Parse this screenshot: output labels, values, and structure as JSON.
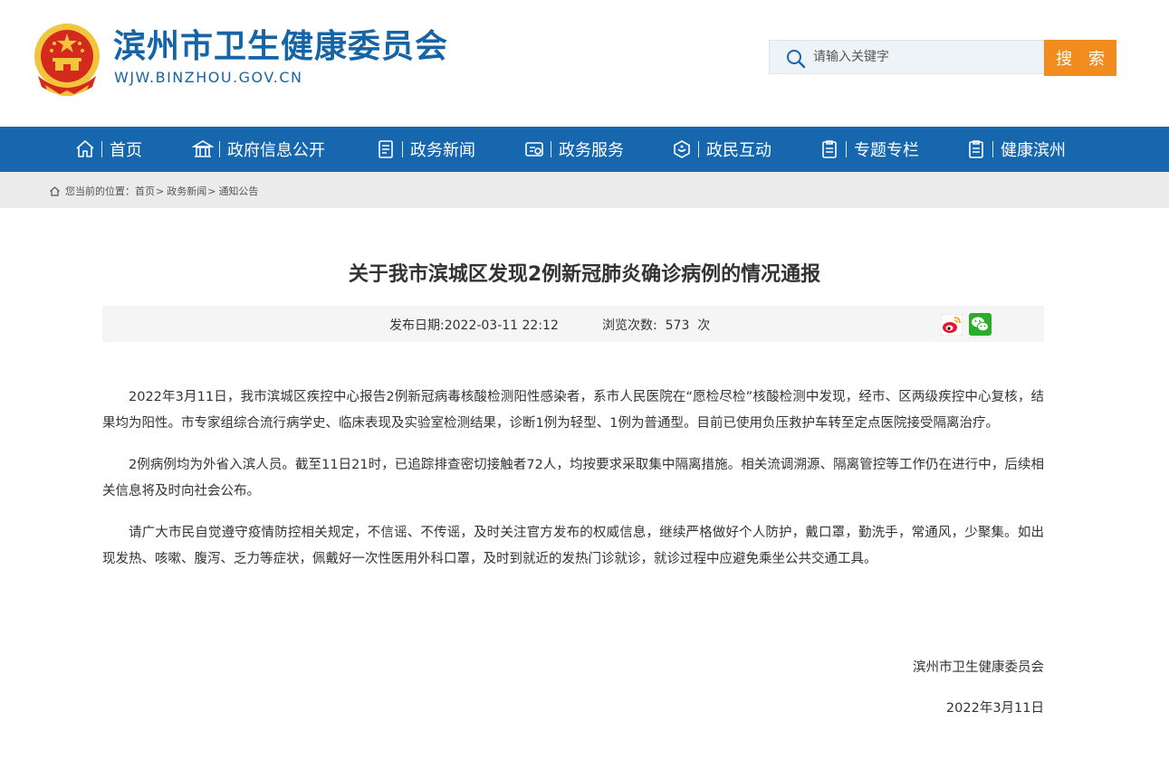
{
  "header": {
    "site_name": "滨州市卫生健康委员会",
    "site_domain": "WJW.BINZHOU.GOV.CN",
    "search_placeholder": "请输入关键字",
    "search_button": "搜 索"
  },
  "nav": {
    "items": [
      {
        "label": "首页",
        "icon": "home-icon"
      },
      {
        "label": "政府信息公开",
        "icon": "building-icon"
      },
      {
        "label": "政务新闻",
        "icon": "document-icon"
      },
      {
        "label": "政务服务",
        "icon": "service-icon"
      },
      {
        "label": "政民互动",
        "icon": "interaction-icon"
      },
      {
        "label": "专题专栏",
        "icon": "clipboard-icon"
      },
      {
        "label": "健康滨州",
        "icon": "health-icon"
      }
    ]
  },
  "breadcrumb": {
    "prefix": "您当前的位置：",
    "items": [
      "首页",
      "政务新闻",
      "通知公告"
    ],
    "separator": ">"
  },
  "article": {
    "title": "关于我市滨城区发现2例新冠肺炎确诊病例的情况通报",
    "publish_label": "发布日期:2022-03-11 22:12",
    "views_label": "浏览次数:",
    "views_count": "573",
    "views_unit": "次",
    "paragraphs": [
      "2022年3月11日，我市滨城区疾控中心报告2例新冠病毒核酸检测阳性感染者，系市人民医院在“愿检尽检”核酸检测中发现，经市、区两级疾控中心复核，结果均为阳性。市专家组综合流行病学史、临床表现及实验室检测结果，诊断1例为轻型、1例为普通型。目前已使用负压救护车转至定点医院接受隔离治疗。",
      "2例病例均为外省入滨人员。截至11日21时，已追踪排查密切接触者72人，均按要求采取集中隔离措施。相关流调溯源、隔离管控等工作仍在进行中，后续相关信息将及时向社会公布。",
      "请广大市民自觉遵守疫情防控相关规定，不信谣、不传谣，及时关注官方发布的权威信息，继续严格做好个人防护，戴口罩，勤洗手，常通风，少聚集。如出现发热、咳嗽、腹泻、乏力等症状，佩戴好一次性医用外科口罩，及时到就近的发热门诊就诊，就诊过程中应避免乘坐公共交通工具。"
    ],
    "signature": "滨州市卫生健康委员会",
    "sign_date": "2022年3月11日"
  },
  "colors": {
    "brand_blue": "#1667ad",
    "search_orange": "#f28c1e",
    "emblem_red": "#d42a1e",
    "emblem_gold": "#f2c53d"
  }
}
